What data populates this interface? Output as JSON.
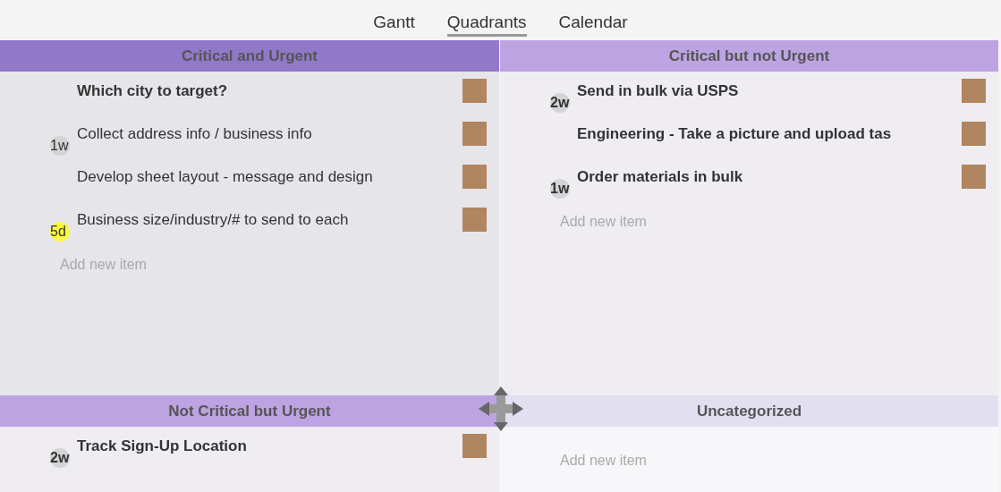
{
  "tabs": [
    {
      "label": "Gantt",
      "selected": false
    },
    {
      "label": "Quadrants",
      "selected": true
    },
    {
      "label": "Calendar",
      "selected": false
    }
  ],
  "quadrants": [
    {
      "title": "Critical and Urgent",
      "color": "#9079c9",
      "items": [
        {
          "text": "Which city to target?",
          "bold": true
        },
        {
          "text": "Collect address info / business info",
          "bold": false,
          "badge": {
            "text": "1w",
            "color": "#d4d4d4"
          }
        },
        {
          "text": "Develop sheet layout - message and design",
          "bold": false
        },
        {
          "text": "Business size/industry/# to send to each",
          "bold": false,
          "badge": {
            "text": "5d",
            "color": "#fbfb3c"
          }
        }
      ],
      "add_label": "Add new item"
    },
    {
      "title": "Critical but not Urgent",
      "color": "#bda3e2",
      "items": [
        {
          "text": "Send in bulk via USPS",
          "bold": true,
          "badge": {
            "text": "2w",
            "color": "#d4d4d4"
          }
        },
        {
          "text": "Engineering - Take a picture and upload tas",
          "bold": true
        },
        {
          "text": "Order materials in bulk",
          "bold": true,
          "badge": {
            "text": "1w",
            "color": "#d4d4d4"
          }
        }
      ],
      "add_label": "Add new item"
    },
    {
      "title": "Not Critical but Urgent",
      "color": "#bda3e2",
      "items": [
        {
          "text": "Track Sign-Up Location",
          "bold": true,
          "badge": {
            "text": "2w",
            "color": "#d4d4d4"
          }
        }
      ]
    },
    {
      "title": "Uncategorized",
      "color": "#e2dff0",
      "add_label": "Add new item"
    }
  ]
}
